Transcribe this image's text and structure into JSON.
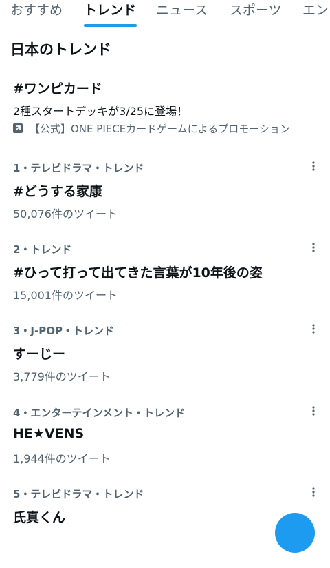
{
  "tabs": [
    {
      "label": "おすすめ"
    },
    {
      "label": "トレンド"
    },
    {
      "label": "ニュース"
    },
    {
      "label": "スポーツ"
    },
    {
      "label": "エン"
    }
  ],
  "active_tab": "トレンド",
  "section_title": "日本のトレンド",
  "promoted": {
    "title": "#ワンピカード",
    "description": "2種スタートデッキが3/25に登場！",
    "promoted_by": "【公式】ONE PIECEカードゲームによるプロモーション",
    "icon": "promoted-arrow-icon"
  },
  "trends": [
    {
      "meta": "1・テレビドラマ・トレンド",
      "name": "#どうする家康",
      "count": "50,076件のツイート"
    },
    {
      "meta": "2・トレンド",
      "name": "#ひって打って出てきた言葉が10年後の姿",
      "count": "15,001件のツイート"
    },
    {
      "meta": "3・J-POP・トレンド",
      "name": "すーじー",
      "count": "3,779件のツイート"
    },
    {
      "meta": "4・エンターテインメント・トレンド",
      "name": "HE★VENS",
      "count": "1,944件のツイート"
    },
    {
      "meta": "5・テレビドラマ・トレンド",
      "name": "氏真くん",
      "count": ""
    }
  ],
  "colors": {
    "accent": "#1d9bf0",
    "secondary_text": "#536471",
    "text": "#0f1419"
  }
}
